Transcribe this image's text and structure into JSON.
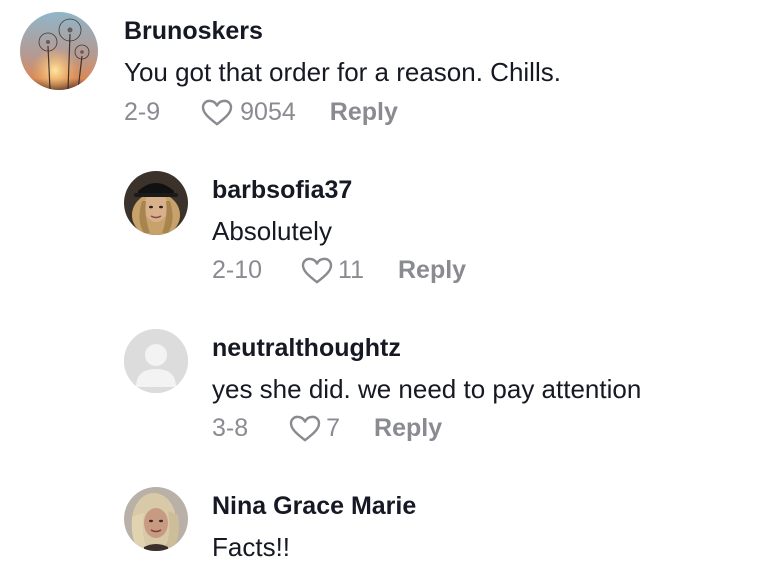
{
  "comments": [
    {
      "username": "Brunoskers",
      "text": "You got that order for a reason. Chills.",
      "date": "2-9",
      "likes": "9054",
      "reply_label": "Reply",
      "avatar_icon": "dandelion-sunset-avatar"
    },
    {
      "username": "barbsofia37",
      "text": "Absolutely",
      "date": "2-10",
      "likes": "11",
      "reply_label": "Reply",
      "avatar_icon": "woman-cap-avatar"
    },
    {
      "username": "neutralthoughtz",
      "text": "yes she did. we need to pay attention",
      "date": "3-8",
      "likes": "7",
      "reply_label": "Reply",
      "avatar_icon": "default-user-avatar"
    },
    {
      "username": "Nina Grace Marie",
      "text": "Facts!!",
      "avatar_icon": "woman-blonde-avatar"
    }
  ],
  "colors": {
    "text": "#161823",
    "muted": "#8a8b91",
    "default_avatar_bg": "#dcdcdc"
  }
}
